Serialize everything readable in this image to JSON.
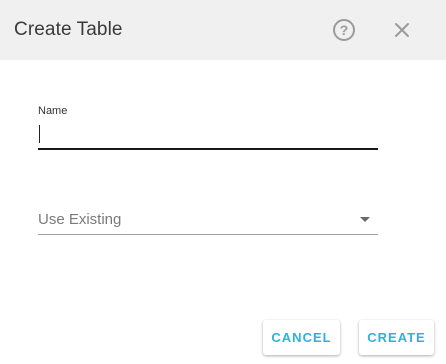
{
  "dialog": {
    "title": "Create Table",
    "help_icon": "help-circle-icon",
    "help_glyph": "?",
    "close_icon": "close-icon"
  },
  "form": {
    "name": {
      "label": "Name",
      "value": ""
    },
    "existing": {
      "selected": "Use Existing",
      "dropdown_icon": "triangle-down-icon"
    }
  },
  "actions": {
    "cancel_label": "CANCEL",
    "create_label": "CREATE"
  },
  "colors": {
    "header_bg": "#f0f0f0",
    "accent": "#2eb3d7",
    "icon_gray": "#9b9b9b"
  }
}
